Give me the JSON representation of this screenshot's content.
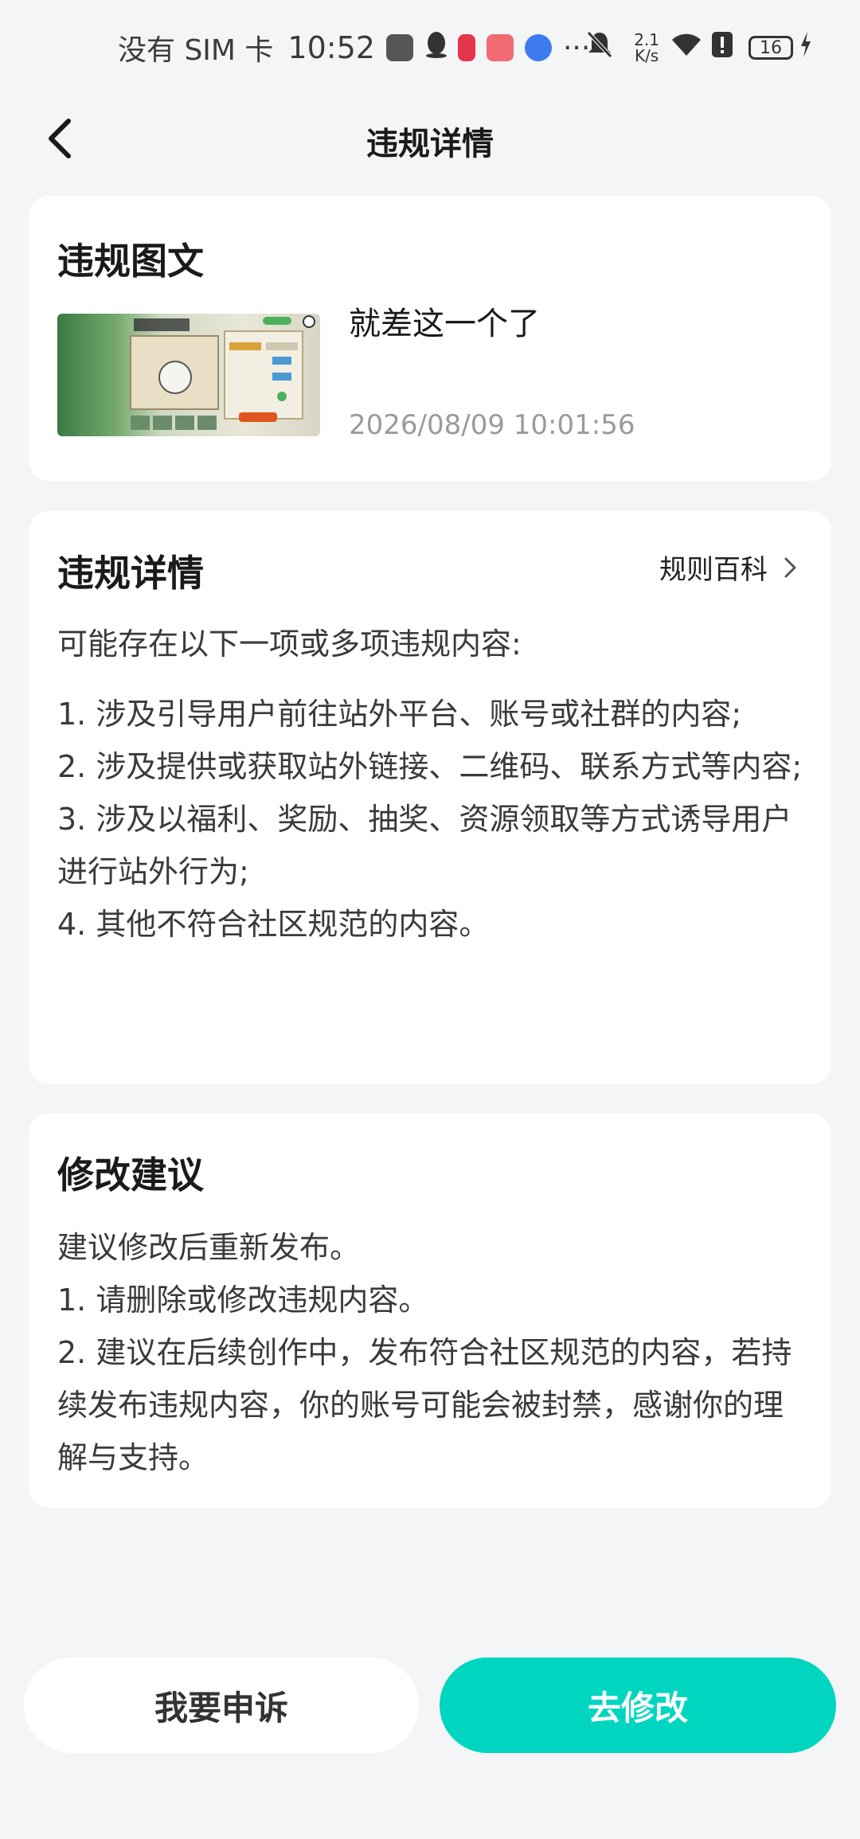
{
  "status_bar": {
    "carrier": "没有 SIM 卡",
    "time": "10:52",
    "ellipsis": "···",
    "net_speed_value": "2.1",
    "net_speed_unit": "K/s",
    "battery": "16"
  },
  "header": {
    "title": "违规详情",
    "back_icon": "chevron-left-icon"
  },
  "post_card": {
    "title": "违规图文",
    "post_text": "就差这一个了",
    "timestamp": "2026/08/09 10:01:56"
  },
  "details_card": {
    "title": "违规详情",
    "rules_link": "规则百科",
    "intro": "可能存在以下一项或多项违规内容:",
    "items": [
      "1. 涉及引导用户前往站外平台、账号或社群的内容;",
      "2. 涉及提供或获取站外链接、二维码、联系方式等内容;",
      "3. 涉及以福利、奖励、抽奖、资源领取等方式诱导用户进行站外行为;",
      "4. 其他不符合社区规范的内容。"
    ]
  },
  "suggestion_card": {
    "title": "修改建议",
    "lines": [
      "建议修改后重新发布。",
      "1. 请删除或修改违规内容。",
      "2. 建议在后续创作中，发布符合社区规范的内容，若持续发布违规内容，你的账号可能会被封禁，感谢你的理解与支持。"
    ]
  },
  "actions": {
    "appeal": "我要申诉",
    "edit": "去修改"
  },
  "colors": {
    "accent": "#00d6bf",
    "background": "#f4f5f7",
    "card": "#ffffff"
  }
}
